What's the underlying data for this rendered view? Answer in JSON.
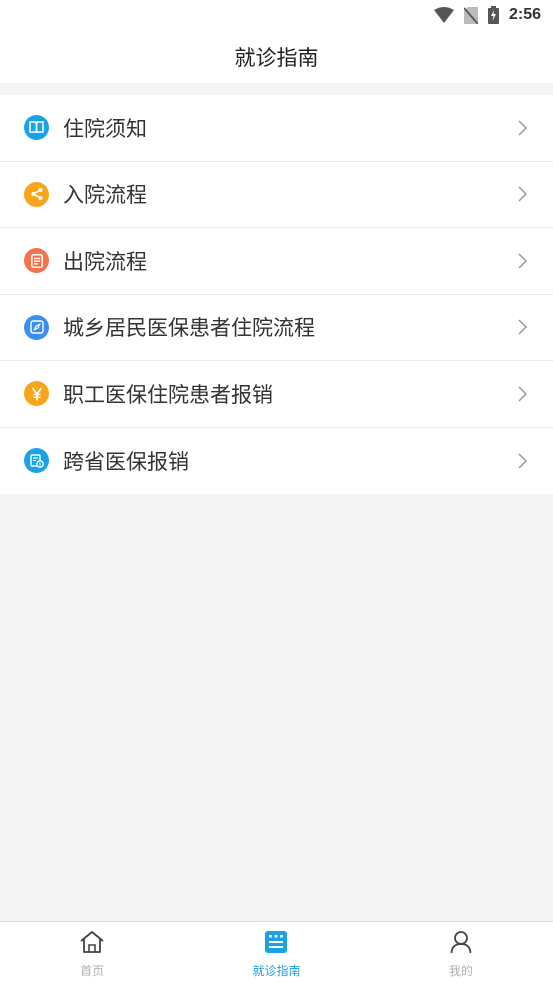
{
  "status_bar": {
    "time": "2:56",
    "icons": [
      "wifi-icon",
      "no-sim-icon",
      "battery-charging-icon"
    ]
  },
  "header": {
    "title": "就诊指南"
  },
  "guide_list": {
    "items": [
      {
        "label": "住院须知",
        "icon": "book-icon",
        "color": "#1aa2e6"
      },
      {
        "label": "入院流程",
        "icon": "share-icon",
        "color": "#f7a51c"
      },
      {
        "label": "出院流程",
        "icon": "document-icon",
        "color": "#f4734a"
      },
      {
        "label": "城乡居民医保患者住院流程",
        "icon": "compass-icon",
        "color": "#3c8ef0"
      },
      {
        "label": "职工医保住院患者报销",
        "icon": "yuan-icon",
        "color": "#f7a51c"
      },
      {
        "label": "跨省医保报销",
        "icon": "receipt-icon",
        "color": "#1aa2e6"
      }
    ]
  },
  "tab_bar": {
    "tabs": [
      {
        "label": "首页",
        "icon": "home-icon",
        "active": false
      },
      {
        "label": "就诊指南",
        "icon": "guide-icon",
        "active": true
      },
      {
        "label": "我的",
        "icon": "user-icon",
        "active": false
      }
    ],
    "active_color": "#1aa2e6",
    "inactive_color": "#b0b0b0"
  }
}
